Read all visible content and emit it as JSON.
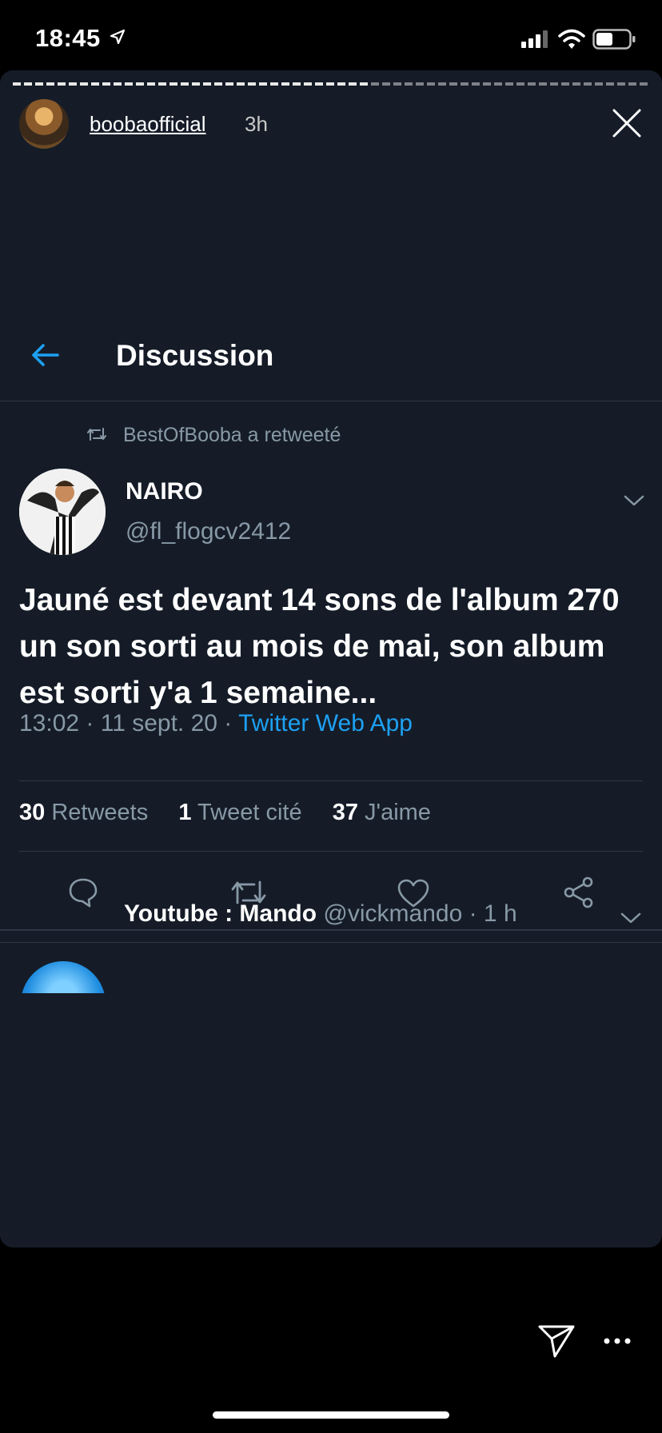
{
  "status_bar": {
    "time": "18:45"
  },
  "story": {
    "username": "boobaofficial",
    "time_ago": "3h"
  },
  "header": {
    "title": "Discussion"
  },
  "tweet": {
    "retweeted_by": "BestOfBooba a retweeté",
    "name": "NAIRO",
    "handle": "@fl_flogcv2412",
    "text": "Jauné est devant 14 sons de l'album 270 un son sorti au mois de mai, son album est sorti y'a 1 semaine...",
    "timestamp": "13:02 · 11 sept. 20 · ",
    "source": "Twitter Web App",
    "stats": {
      "retweets_count": "30",
      "retweets_label": "Retweets",
      "quotes_count": "1",
      "quotes_label": "Tweet cité",
      "likes_count": "37",
      "likes_label": "J'aime"
    }
  },
  "reply": {
    "name": "Youtube : Mando",
    "meta": "@vickmando · 1 h"
  },
  "colors": {
    "bg": "#151c28",
    "accent": "#1da1f2",
    "muted": "#8899a6"
  }
}
